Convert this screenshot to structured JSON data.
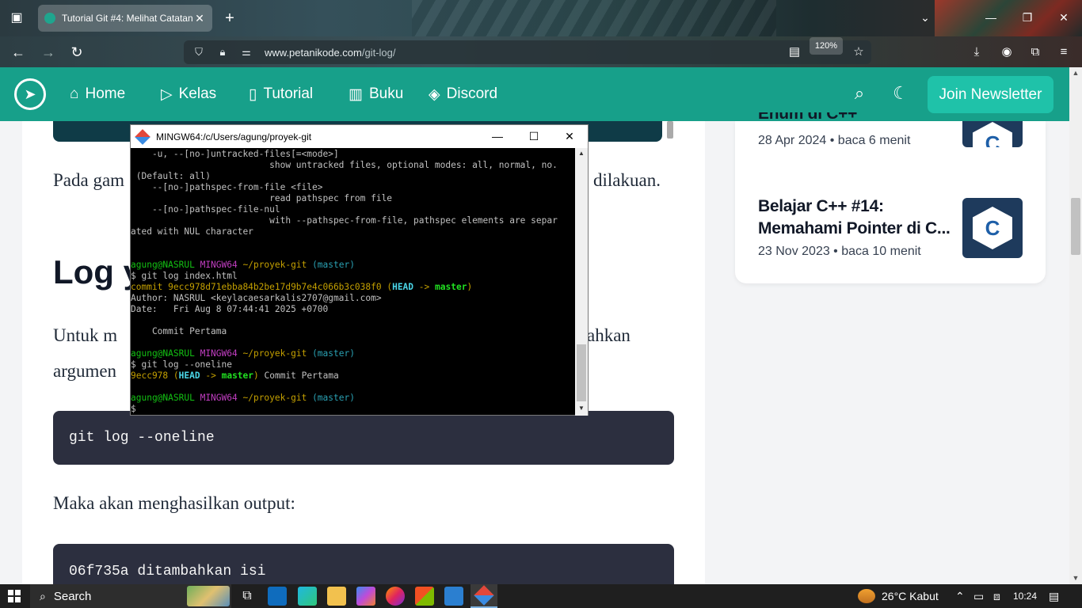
{
  "browser": {
    "tab_title": "Tutorial Git #4: Melihat Catatan",
    "tab_close": "✕",
    "new_tab": "+",
    "url_host": "www.petanikode.com",
    "url_path": "/git-log/",
    "zoom": "120%"
  },
  "site": {
    "nav": [
      "Home",
      "Kelas",
      "Tutorial",
      "Buku",
      "Discord"
    ],
    "newsletter": "Join Newsletter"
  },
  "article": {
    "para1_start": "Pada gam",
    "para1_end": "dilakuan.",
    "heading": "Log y",
    "para2_line1_start": "Untuk m",
    "para2_line1_end": "ahkan",
    "para2_line2_start": "argumen",
    "code1": "git log --oneline",
    "para3": "Maka akan menghasilkan output:",
    "code2": "06f735a ditambahkan isi"
  },
  "sidebar": {
    "items": [
      {
        "title": "Enum di C++",
        "meta": "28 Apr 2024 • baca 6 menit"
      },
      {
        "title": "Belajar C++ #14:",
        "title2": "Memahami Pointer di C...",
        "meta": "23 Nov 2023 • baca 10 menit"
      }
    ]
  },
  "terminal": {
    "title": "MINGW64:/c/Users/agung/proyek-git",
    "help_lines": [
      "    -u, --[no-]untracked-files[=<mode>]",
      "                          show untracked files, optional modes: all, normal, no.",
      " (Default: all)",
      "    --[no-]pathspec-from-file <file>",
      "                          read pathspec from file",
      "    --[no-]pathspec-file-nul",
      "                          with --pathspec-from-file, pathspec elements are separ",
      "ated with NUL character"
    ],
    "prompt_user": "agung@NASRUL",
    "prompt_env": "MINGW64",
    "prompt_path": "~/proyek-git",
    "prompt_branch": "(master)",
    "cmd1": "$ git log index.html",
    "commit_label": "commit 9ecc978d71ebba84b2be17d9b7e4c066b3c038f0",
    "head": "HEAD",
    "arrow": "->",
    "branch": "master",
    "author": "Author: NASRUL <keylacaesarkalis2707@gmail.com>",
    "date": "Date:   Fri Aug 8 07:44:41 2025 +0700",
    "message": "    Commit Pertama",
    "cmd2": "$ git log --oneline",
    "short_hash": "9ecc978",
    "oneline_msg": " Commit Pertama",
    "cursor": "$"
  },
  "taskbar": {
    "search": "Search",
    "weather": "26°C  Kabut",
    "time": "10:24"
  },
  "colors": {
    "teal": "#17a08a",
    "button": "#1fc2a9",
    "code_bg": "#2c2f3f"
  }
}
